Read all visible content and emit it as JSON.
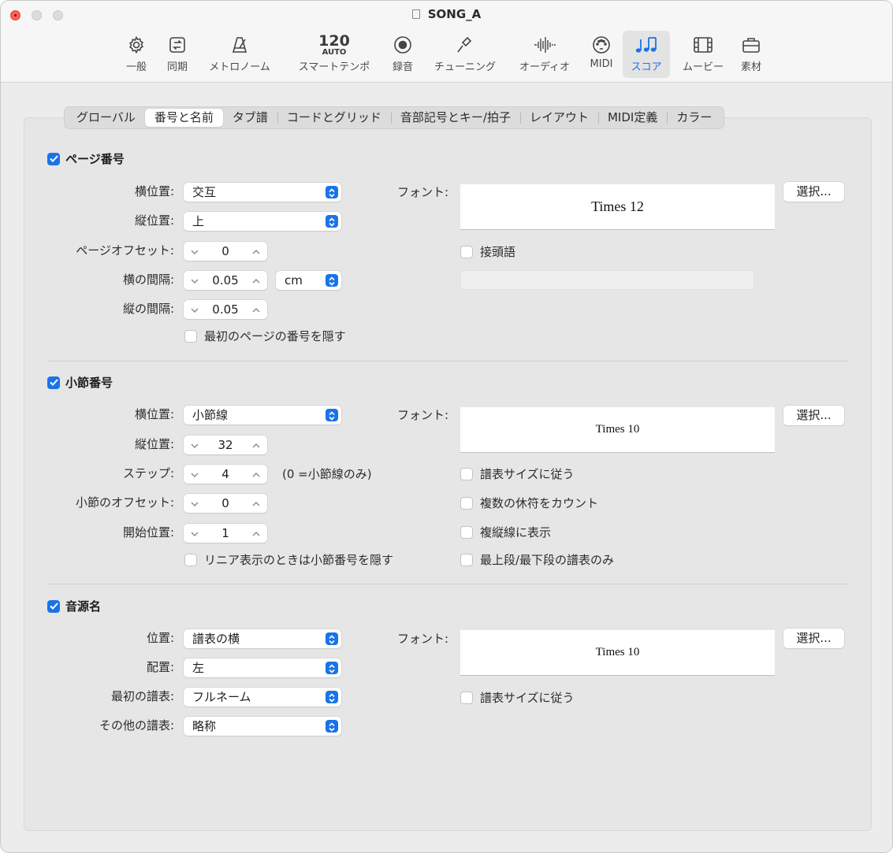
{
  "window": {
    "title": "SONG_A"
  },
  "toolbar": {
    "items": [
      {
        "label": "一般",
        "icon": "gear-icon"
      },
      {
        "label": "同期",
        "icon": "sync-icon"
      },
      {
        "label": "メトロノーム",
        "icon": "metronome-icon"
      },
      {
        "label": "スマートテンポ",
        "icon": "tempo-icon",
        "tempo_value": "120",
        "tempo_mode": "AUTO"
      },
      {
        "label": "録音",
        "icon": "record-icon"
      },
      {
        "label": "チューニング",
        "icon": "tuning-fork-icon"
      },
      {
        "label": "オーディオ",
        "icon": "waveform-icon"
      },
      {
        "label": "MIDI",
        "icon": "midi-port-icon"
      },
      {
        "label": "スコア",
        "icon": "score-notes-icon",
        "active": true
      },
      {
        "label": "ムービー",
        "icon": "film-icon"
      },
      {
        "label": "素材",
        "icon": "briefcase-icon"
      }
    ]
  },
  "tabs": [
    "グローバル",
    "番号と名前",
    "タブ譜",
    "コードとグリッド",
    "音部記号とキー/拍子",
    "レイアウト",
    "MIDI定義",
    "カラー"
  ],
  "active_tab": "番号と名前",
  "colors": {
    "accent": "#1a73e8",
    "close": "#fe5f57"
  },
  "page_numbers": {
    "heading": "ページ番号",
    "checked": true,
    "horizontal_label": "横位置:",
    "horizontal_value": "交互",
    "vertical_label": "縦位置:",
    "vertical_value": "上",
    "offset_label": "ページオフセット:",
    "offset_value": "0",
    "h_spacing_label": "横の間隔:",
    "h_spacing_value": "0.05",
    "unit_value": "cm",
    "v_spacing_label": "縦の間隔:",
    "v_spacing_value": "0.05",
    "hide_first_label": "最初のページの番号を隠す",
    "hide_first_checked": false,
    "font_label": "フォント:",
    "font_value": "Times 12",
    "select_label": "選択...",
    "prefix_label": "接頭語",
    "prefix_checked": false,
    "prefix_value": ""
  },
  "bar_numbers": {
    "heading": "小節番号",
    "checked": true,
    "horizontal_label": "横位置:",
    "horizontal_value": "小節線",
    "vertical_label": "縦位置:",
    "vertical_value": "32",
    "step_label": "ステップ:",
    "step_value": "4",
    "step_note": "(0 =小節線のみ)",
    "offset_label": "小節のオフセット:",
    "offset_value": "0",
    "start_label": "開始位置:",
    "start_value": "1",
    "hide_linear_label": "リニア表示のときは小節番号を隠す",
    "font_label": "フォント:",
    "font_value": "Times 10",
    "select_label": "選択...",
    "follow_size_label": "譜表サイズに従う",
    "count_rests_label": "複数の休符をカウント",
    "double_bar_label": "複縦線に表示",
    "top_bottom_label": "最上段/最下段の譜表のみ"
  },
  "instrument_names": {
    "heading": "音源名",
    "checked": true,
    "position_label": "位置:",
    "position_value": "譜表の横",
    "alignment_label": "配置:",
    "alignment_value": "左",
    "first_staff_label": "最初の譜表:",
    "first_staff_value": "フルネーム",
    "other_staff_label": "その他の譜表:",
    "other_staff_value": "略称",
    "font_label": "フォント:",
    "font_value": "Times 10",
    "select_label": "選択...",
    "follow_size_label": "譜表サイズに従う"
  }
}
